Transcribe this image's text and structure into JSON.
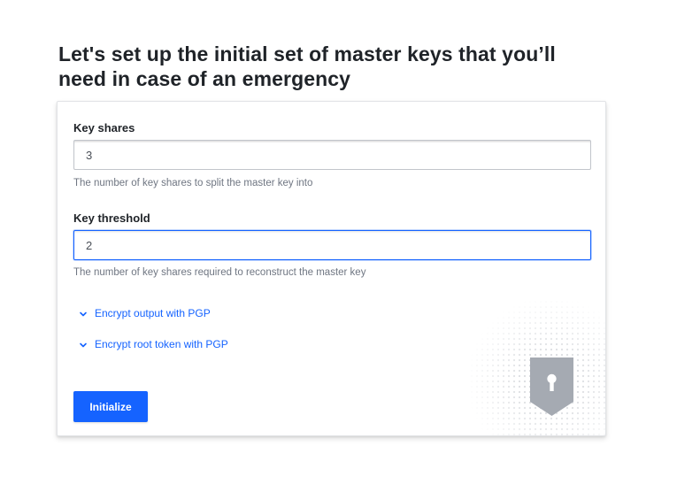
{
  "page": {
    "title": "Let's set up the initial set of master keys that you’ll need in case of an emergency"
  },
  "form": {
    "key_shares": {
      "label": "Key shares",
      "value": "3",
      "help": "The number of key shares to split the master key into"
    },
    "key_threshold": {
      "label": "Key threshold",
      "value": "2",
      "help": "The number of key shares required to reconstruct the master key"
    },
    "toggles": [
      {
        "label": "Encrypt output with PGP",
        "icon": "chevron-down-icon"
      },
      {
        "label": "Encrypt root token with PGP",
        "icon": "chevron-down-icon"
      }
    ],
    "submit_label": "Initialize"
  },
  "decoration": {
    "icon": "shield-keyhole-icon"
  },
  "colors": {
    "accent": "#1563ff",
    "text": "#1f2328",
    "muted": "#6f7682",
    "border": "#c2c5cb"
  }
}
